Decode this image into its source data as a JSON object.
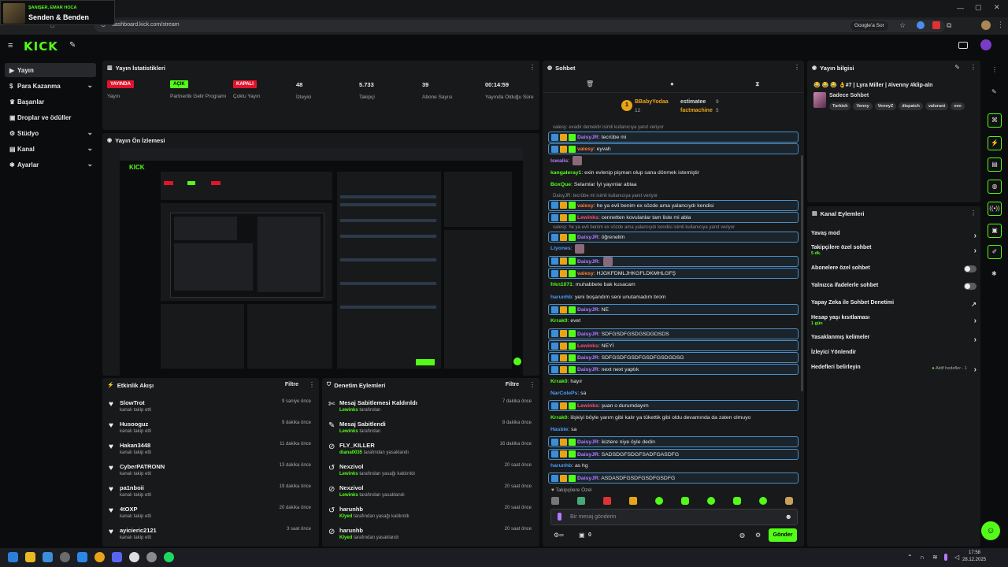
{
  "browser": {
    "url": "dashboard.kick.com/stream",
    "google_button": "Google'a Sor",
    "media_artist": "ŞANIŞER, EMAR HOCA",
    "media_title": "Senden & Benden"
  },
  "brand": {
    "logo": "KICK",
    "accent": "#53fc18"
  },
  "sidebar": {
    "items": [
      {
        "label": "Yayın",
        "icon": "video-icon",
        "active": true
      },
      {
        "label": "Para Kazanma",
        "icon": "dollar-icon",
        "chevron": true
      },
      {
        "label": "Başarılar",
        "icon": "trophy-icon"
      },
      {
        "label": "Droplar ve ödüller",
        "icon": "gift-icon"
      },
      {
        "label": "Stüdyo",
        "icon": "studio-icon",
        "chevron": true
      },
      {
        "label": "Kanal",
        "icon": "user-icon",
        "chevron": true
      },
      {
        "label": "Ayarlar",
        "icon": "gear-icon",
        "chevron": true
      }
    ]
  },
  "stats_panel": {
    "title": "Yayın İstatistikleri",
    "items": [
      {
        "badge": "YAYINDA",
        "badge_color": "#e0142a",
        "label": "Yayın"
      },
      {
        "badge": "AÇIK",
        "badge_color": "#53fc18",
        "label": "Partnerlik Gelir Programı"
      },
      {
        "badge": "KAPALI",
        "badge_color": "#e0142a",
        "label": "Çoklu Yayın"
      },
      {
        "value": "48",
        "label": "İzleyici"
      },
      {
        "value": "5.733",
        "label": "Takipçi"
      },
      {
        "value": "39",
        "label": "Abone Sayısı"
      },
      {
        "value": "00:14:59",
        "label": "Yayında Olduğu Süre"
      }
    ]
  },
  "preview_panel": {
    "title": "Yayın Ön İzlemesi"
  },
  "activity_feed": {
    "title": "Etkinlik Akışı",
    "filter": "Filtre",
    "rows": [
      {
        "name": "SlowTrot",
        "sub": "kanalı takip etti",
        "time": "9 saniye önce"
      },
      {
        "name": "Husooguz",
        "sub": "kanalı takip etti",
        "time": "9 dakika önce"
      },
      {
        "name": "Hakan3448",
        "sub": "kanalı takip etti",
        "time": "11 dakika önce"
      },
      {
        "name": "CyberPATRONN",
        "sub": "kanalı takip etti",
        "time": "13 dakika önce"
      },
      {
        "name": "pa1nboii",
        "sub": "kanalı takip etti",
        "time": "19 dakika önce"
      },
      {
        "name": "4tOXP",
        "sub": "kanalı takip etti",
        "time": "20 dakika önce"
      },
      {
        "name": "ayicieric2121",
        "sub": "kanalı takip etti",
        "time": "3 saat önce"
      }
    ]
  },
  "moderation": {
    "title": "Denetim Eylemleri",
    "filter": "Filtre",
    "rows": [
      {
        "name": "Mesaj Sabitlemesi Kaldırıldı",
        "actor": "Lewinks",
        "sub": "tarafından",
        "time": "7 dakika önce",
        "icon": "unpin-icon"
      },
      {
        "name": "Mesaj Sabitlendi",
        "actor": "Lewinks",
        "sub": "tarafından",
        "time": "8 dakika önce",
        "icon": "pin-icon"
      },
      {
        "name": "FLY_KILLER",
        "actor": "diana0035",
        "sub": "tarafından yasaklandı",
        "time": "16 dakika önce",
        "icon": "ban-icon"
      },
      {
        "name": "Nexzivol",
        "actor": "Lewinks",
        "sub": "tarafından yasağı kaldırıldı",
        "time": "20 saat önce",
        "icon": "undo-icon"
      },
      {
        "name": "Nexzivol",
        "actor": "Lewinks",
        "sub": "tarafından yasaklandı",
        "time": "20 saat önce",
        "icon": "ban-icon"
      },
      {
        "name": "harunhb",
        "actor": "Klyed",
        "sub": "tarafından yasağı kaldırıldı",
        "time": "20 saat önce",
        "icon": "undo-icon"
      },
      {
        "name": "harunhb",
        "actor": "Klyed",
        "sub": "tarafından yasaklandı",
        "time": "20 saat önce",
        "icon": "ban-icon"
      }
    ]
  },
  "chat": {
    "title": "Sohbet",
    "top_gifters": [
      {
        "rank": "1",
        "name": "BBabyYodaa",
        "count": "12"
      },
      {
        "name": "estimatee",
        "count": "9"
      },
      {
        "name": "factmachine",
        "count": "5"
      }
    ],
    "messages": [
      {
        "reply": "valesy: evadir demektir isimli kullanıcıya yanıt veriyor"
      },
      {
        "user": "DaisyJR",
        "color": "#b37bff",
        "text": "tecrübe mi",
        "hl": true
      },
      {
        "user": "valesy",
        "color": "#ff7b2f",
        "text": "eyvah",
        "hl": true
      },
      {
        "user": "Iswalis",
        "color": "#b37bff",
        "text": ""
      },
      {
        "user": "kangaleray1",
        "color": "#53fc18",
        "text": "exin evlenip pişman olup sana dönmek istemiştir"
      },
      {
        "user": "BoxQue",
        "color": "#53fc18",
        "text": "Selamlar İyi yayınlar ablaa"
      },
      {
        "reply": "DaisyJR: tecrübe mi isimli kullanıcıya yanıt veriyor"
      },
      {
        "user": "valesy",
        "color": "#ff7b2f",
        "text": "he ya evli benim ex sözde ama yalancıydı kendisi",
        "hl": true
      },
      {
        "user": "Lewinks",
        "color": "#ff4d6d",
        "text": "cennetten kovulanlar tam liste mi abla",
        "hl": true
      },
      {
        "reply": "valesy: he ya evli benim ex sözde ama yalancıydı kendisi isimli kullanıcıya yanıt veriyor"
      },
      {
        "user": "DaisyJR",
        "color": "#b37bff",
        "text": "öğrenelim",
        "hl": true
      },
      {
        "user": "Liyones",
        "color": "#4a9cff",
        "text": ""
      },
      {
        "user": "DaisyJR",
        "color": "#b37bff",
        "text": "",
        "hl": true
      },
      {
        "user": "valesy",
        "color": "#ff7b2f",
        "text": "HJGKFDMLJHKGFLDKMHLGFŞ",
        "hl": true
      },
      {
        "user": "frkn1071",
        "color": "#53fc18",
        "text": "muhabbete bak kusacam"
      },
      {
        "user": "harunhb",
        "color": "#4a9cff",
        "text": "yeni boşandım seni unutamadım brom"
      },
      {
        "user": "DaisyJR",
        "color": "#b37bff",
        "text": "NE",
        "hl": true
      },
      {
        "user": "Krrak0",
        "color": "#53fc18",
        "text": "evet"
      },
      {
        "user": "DaisyJR",
        "color": "#b37bff",
        "text": "SDFGSDFGSDGSDGDSDS",
        "hl": true
      },
      {
        "user": "Lewinks",
        "color": "#ff4d6d",
        "text": "NEYİ",
        "hl": true
      },
      {
        "user": "DaisyJR",
        "color": "#b37bff",
        "text": "SDFGSDFGSDFGSDFGSDGDSG",
        "hl": true
      },
      {
        "user": "DaisyJR",
        "color": "#b37bff",
        "text": "next next yaptık",
        "hl": true
      },
      {
        "user": "Krrak0",
        "color": "#53fc18",
        "text": "hayır"
      },
      {
        "user": "NarColePs",
        "color": "#4a9cff",
        "text": "sa"
      },
      {
        "user": "Lewinks",
        "color": "#ff4d6d",
        "text": "şuan o durumdayım",
        "hl": true
      },
      {
        "user": "Krrak0",
        "color": "#53fc18",
        "text": "ilişkiyi böyle yarım gibi kalır ya tükettik gibi oldu devamında da zaten olmuyo"
      },
      {
        "user": "Hasbie",
        "color": "#4a9cff",
        "text": "sa"
      },
      {
        "user": "DaisyJR",
        "color": "#b37bff",
        "text": "ikizlere niye öyle dedin",
        "hl": true
      },
      {
        "user": "DaisyJR",
        "color": "#b37bff",
        "text": "SADSDGFSDGFSADFGASDFG",
        "hl": true
      },
      {
        "user": "harunhb",
        "color": "#4a9cff",
        "text": "as hg"
      },
      {
        "user": "DaisyJR",
        "color": "#b37bff",
        "text": "ASDASDFGSDFGSDFGSDFG",
        "hl": true
      }
    ],
    "followers_only_label": "Takipçilere Özel",
    "input_placeholder": "Bir mesaj gönderin",
    "points": "0",
    "send_label": "Gönder"
  },
  "stream_info": {
    "title": "Yayın bilgisi",
    "stream_title": "😂 😂 😂 👌#7 | Lyra Miller | #ivenny #klip-aln",
    "category": "Sadece Sohbet",
    "tags": [
      "Turkish",
      "Venny",
      "VennyZ",
      "dispatch",
      "valorant",
      "ven"
    ]
  },
  "channel_actions": {
    "title": "Kanal Eylemleri",
    "items": [
      {
        "label": "Yavaş mod",
        "type": "arrow"
      },
      {
        "label": "Takipçilere özel sohbet",
        "sub": "5 dk.",
        "type": "arrow"
      },
      {
        "label": "Abonelere özel sohbet",
        "type": "toggle"
      },
      {
        "label": "Yalnızca ifadelerle sohbet",
        "type": "toggle"
      },
      {
        "label": "Yapay Zeka ile Sohbet Denetimi",
        "type": "external"
      },
      {
        "label": "Hesap yaşı kısıtlaması",
        "sub": "1 gün",
        "type": "arrow"
      },
      {
        "label": "Yasaklanmış kelimeler",
        "type": "arrow"
      },
      {
        "label": "İzleyici Yönlendir",
        "type": "none"
      },
      {
        "label": "Hedefleri belirleyin",
        "status": "Aktif hedefler - 1",
        "type": "arrow"
      }
    ]
  },
  "taskbar": {
    "time": "17:58",
    "date": "28.12.2025"
  }
}
